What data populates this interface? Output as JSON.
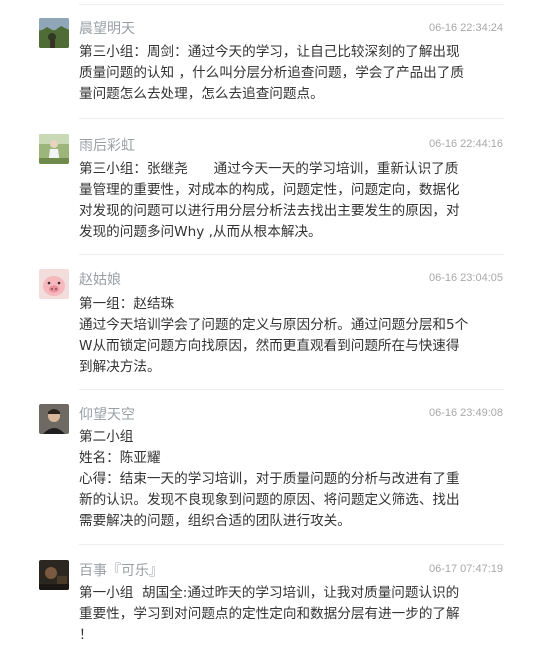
{
  "comments": [
    {
      "username": "晨望明天",
      "timestamp": "06-16 22:34:24",
      "avatar": "landscape-photo-avatar",
      "lines": [
        "第三小组：周剑：通过今天的学习，让自己比较深刻的了解出现",
        "质量问题的认知 ，什么叫分层分析追查问题，学会了产品出了质",
        "量问题怎么去处理，怎么去追查问题点。"
      ]
    },
    {
      "username": "雨后彩虹",
      "timestamp": "06-16 22:44:16",
      "avatar": "person-outdoor-avatar",
      "lines": [
        "第三小组：张继尧      通过今天一天的学习培训，重新认识了质",
        "量管理的重要性，对成本的构成，问题定性，问题定向，数据化",
        "对发现的问题可以进行用分层分析法去找出主要发生的原因，对",
        "发现的问题多问Why ,从而从根本解决。"
      ]
    },
    {
      "username": "赵姑娘",
      "timestamp": "06-16 23:04:05",
      "avatar": "pink-pig-avatar",
      "lines": [
        "第一组：赵结珠",
        "通过今天培训学会了问题的定义与原因分析。通过问题分层和5个",
        "W从而锁定问题方向找原因，然而更直观看到问题所在与快速得",
        "到解决方法。"
      ]
    },
    {
      "username": "仰望天空",
      "timestamp": "06-16 23:49:08",
      "avatar": "person-portrait-avatar",
      "lines": [
        "第二小组",
        "姓名：陈亚耀",
        "心得：结束一天的学习培训，对于质量问题的分析与改进有了重",
        "新的认识。发现不良现象到问题的原因、将问题定义筛选、找出",
        "需要解决的问题，组织合适的团队进行攻关。"
      ]
    },
    {
      "username": "百事『可乐』",
      "timestamp": "06-17 07:47:19",
      "avatar": "dark-photo-avatar",
      "lines": [
        "第一小组  胡国全:通过昨天的学习培训，让我对质量问题认识的",
        "重要性，学习到对问题点的定性定向和数据分层有进一步的了解",
        "！"
      ]
    }
  ]
}
